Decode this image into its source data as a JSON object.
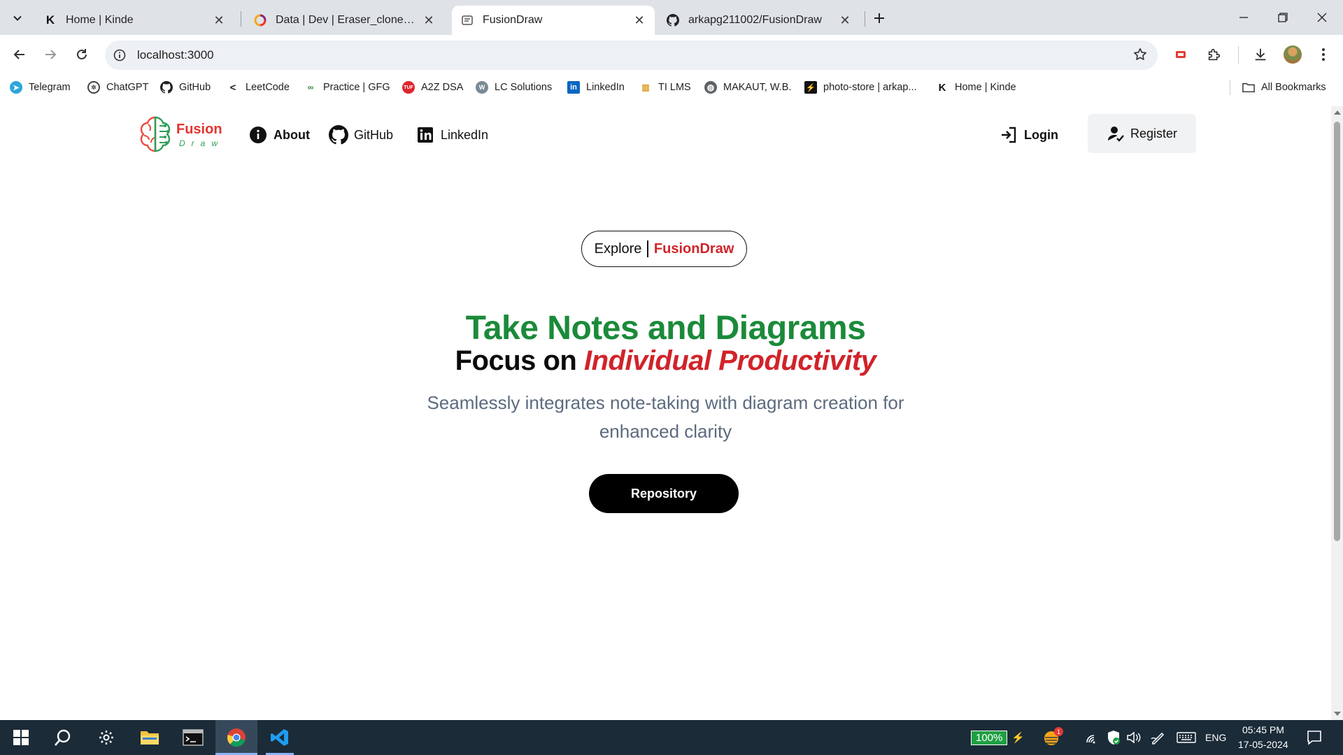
{
  "browser": {
    "tabs": [
      {
        "title": "Home | Kinde",
        "favicon": "kinde-k-icon",
        "active": false
      },
      {
        "title": "Data | Dev | Eraser_clone | Conv",
        "favicon": "convex-icon",
        "active": false
      },
      {
        "title": "FusionDraw",
        "favicon": "fusiondraw-icon",
        "active": true
      },
      {
        "title": "arkapg211002/FusionDraw",
        "favicon": "github-icon",
        "active": false
      }
    ],
    "new_tab_icon": "plus-icon",
    "url": "localhost:3000",
    "bookmarks": [
      {
        "label": "Telegram",
        "icon": "telegram-icon"
      },
      {
        "label": "ChatGPT",
        "icon": "chatgpt-icon"
      },
      {
        "label": "GitHub",
        "icon": "github-icon"
      },
      {
        "label": "LeetCode",
        "icon": "leetcode-icon"
      },
      {
        "label": "Practice | GFG",
        "icon": "gfg-icon"
      },
      {
        "label": "A2Z DSA",
        "icon": "tuf-icon"
      },
      {
        "label": "LC Solutions",
        "icon": "lc-solutions-icon"
      },
      {
        "label": "LinkedIn",
        "icon": "linkedin-icon"
      },
      {
        "label": "TI LMS",
        "icon": "ti-lms-icon"
      },
      {
        "label": "MAKAUT, W.B.",
        "icon": "globe-icon"
      },
      {
        "label": "photo-store | arkap...",
        "icon": "photo-store-icon"
      },
      {
        "label": "Home | Kinde",
        "icon": "kinde-k-icon"
      }
    ],
    "all_bookmarks": "All Bookmarks"
  },
  "site": {
    "logo_text_top": "Fusion",
    "logo_text_bottom": "Draw",
    "nav": {
      "about": "About",
      "github": "GitHub",
      "linkedin": "LinkedIn",
      "login": "Login",
      "register": "Register"
    },
    "explore": "Explore",
    "explore_brand": "FusionDraw",
    "hero_title": "Take Notes and Diagrams",
    "hero_sub_prefix": "Focus on ",
    "hero_sub_highlight": "Individual Productivity",
    "hero_desc": "Seamlessly integrates note-taking with diagram creation for enhanced clarity",
    "repo_button": "Repository"
  },
  "taskbar": {
    "battery": "100%",
    "language": "ENG",
    "time": "05:45 PM",
    "date": "17-05-2024",
    "notification_badge": "1"
  },
  "colors": {
    "brand_green": "#1b8a3a",
    "brand_red": "#d1232a",
    "desc_gray": "#5d6b7e"
  }
}
